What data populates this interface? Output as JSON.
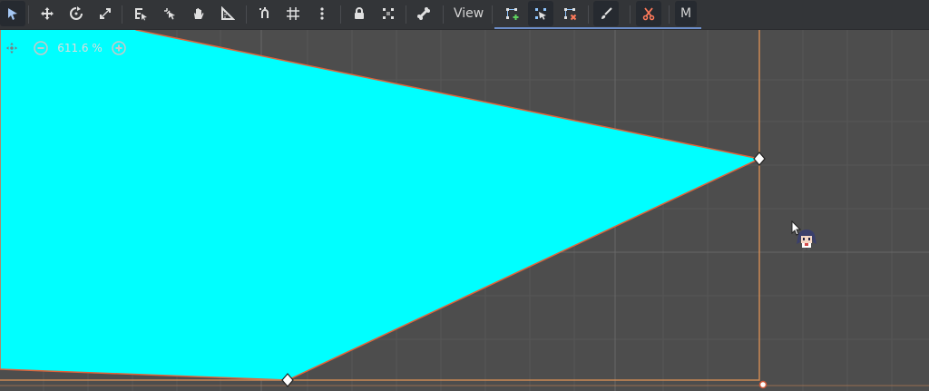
{
  "toolbar": {
    "buttons": [
      {
        "name": "select-mode-button",
        "icon": "select-arrow-icon",
        "active": true
      },
      {
        "name": "move-mode-button",
        "icon": "move-icon"
      },
      {
        "name": "rotate-mode-button",
        "icon": "rotate-icon"
      },
      {
        "name": "scale-mode-button",
        "icon": "scale-icon"
      },
      {
        "name": "list-select-button",
        "icon": "list-select-icon"
      },
      {
        "name": "pivot-mode-button",
        "icon": "pivot-icon"
      },
      {
        "name": "pan-mode-button",
        "icon": "hand-icon"
      },
      {
        "name": "ruler-mode-button",
        "icon": "ruler-icon"
      },
      {
        "name": "smart-snap-button",
        "icon": "snap-icon"
      },
      {
        "name": "grid-snap-button",
        "icon": "grid-icon"
      },
      {
        "name": "snap-options-button",
        "icon": "more-vertical-icon"
      },
      {
        "name": "lock-button",
        "icon": "lock-icon"
      },
      {
        "name": "group-button",
        "icon": "group-icon"
      },
      {
        "name": "skeleton-button",
        "icon": "bone-icon"
      }
    ],
    "view_label": "View",
    "polygon_tools": [
      {
        "name": "create-points-button",
        "icon": "add-point-icon"
      },
      {
        "name": "edit-points-button",
        "icon": "edit-point-icon",
        "active": true
      },
      {
        "name": "delete-points-button",
        "icon": "delete-point-icon"
      }
    ],
    "paint_button_icon": "brush-icon",
    "cut_button_icon": "scissors-icon",
    "m_label": "M"
  },
  "zoom": {
    "label": "611.6 %",
    "reset_icon": "center-view-icon",
    "out_icon": "zoom-out-icon",
    "in_icon": "zoom-in-icon"
  },
  "colors": {
    "polygon_fill": "#00ffff",
    "polygon_outline": "#e0633a",
    "bounds_line": "#cc8a55",
    "background": "#4d4d4d",
    "grid": "#575757",
    "toolbar_bg": "#333538",
    "accent": "#6b8cc7"
  }
}
